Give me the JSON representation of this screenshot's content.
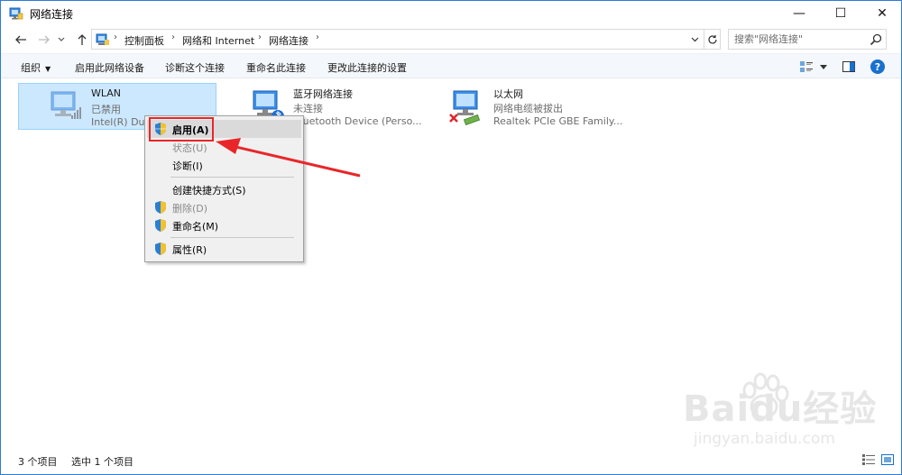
{
  "window": {
    "title": "网络连接",
    "minimize_glyph": "—",
    "maximize_glyph": "☐",
    "close_glyph": "✕"
  },
  "address": {
    "crumbs": [
      "控制面板",
      "网络和 Internet",
      "网络连接"
    ],
    "separator": "›"
  },
  "search": {
    "placeholder": "搜索\"网络连接\""
  },
  "toolbar": {
    "organize": "组织",
    "enable_device": "启用此网络设备",
    "diagnose": "诊断这个连接",
    "rename": "重命名此连接",
    "change_settings": "更改此连接的设置"
  },
  "connections": [
    {
      "name": "WLAN",
      "status": "已禁用",
      "device": "Intel(R) Dual Band Wireless-AC 8265"
    },
    {
      "name": "蓝牙网络连接",
      "status": "未连接",
      "device": "Bluetooth Device (Perso..."
    },
    {
      "name": "以太网",
      "status": "网络电缆被拔出",
      "device": "Realtek PCIe GBE Family..."
    }
  ],
  "context_menu": {
    "enable": "启用(A)",
    "status": "状态(U)",
    "diagnose": "诊断(I)",
    "create_shortcut": "创建快捷方式(S)",
    "delete": "删除(D)",
    "rename": "重命名(M)",
    "properties": "属性(R)"
  },
  "statusbar": {
    "item_count": "3 个项目",
    "selected": "选中 1 个项目"
  },
  "watermark": {
    "brand": "Baidu经验",
    "url": "jingyan.baidu.com"
  },
  "colors": {
    "selection": "#cce8ff",
    "accent": "#1870cf",
    "annotation": "#e8262a"
  }
}
